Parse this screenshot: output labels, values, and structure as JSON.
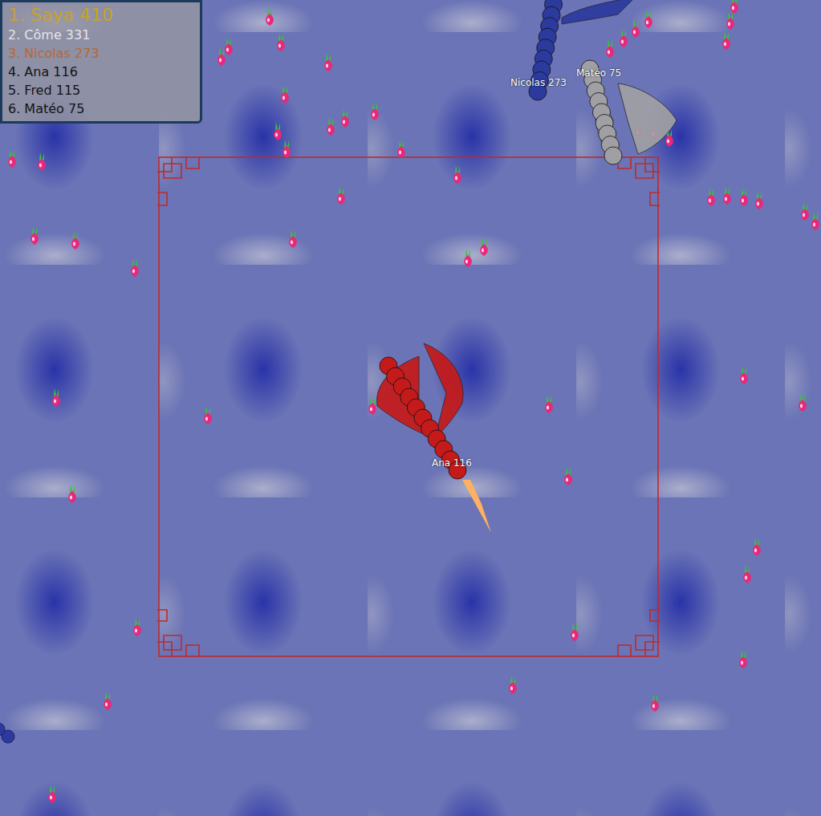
{
  "leaderboard": [
    {
      "text": "1. Saya 410",
      "color": "#c9a227"
    },
    {
      "text": "2. Côme 331",
      "color": "#e4e4e8"
    },
    {
      "text": "3. Nicolas 273",
      "color": "#b8682e"
    },
    {
      "text": "4. Ana 116",
      "color": "#141414"
    },
    {
      "text": "5. Fred 115",
      "color": "#141414"
    },
    {
      "text": "6. Matéo 75",
      "color": "#141414"
    }
  ],
  "players": [
    {
      "label": "Nicolas 273",
      "color": "#2c3a9e"
    },
    {
      "label": "Matéo 75",
      "color": "#a0a0a4"
    },
    {
      "label": "Ana 116",
      "color": "#c41a1a"
    }
  ]
}
